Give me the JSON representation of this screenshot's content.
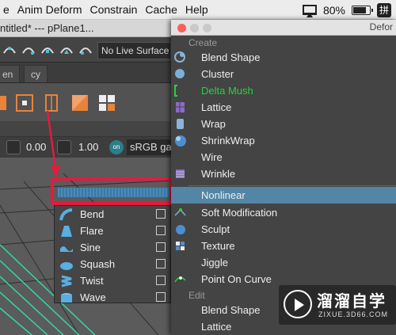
{
  "menubar": {
    "items": [
      "e",
      "Anim Deform",
      "Constrain",
      "Cache",
      "Help"
    ],
    "battery": "80%",
    "ime": "拼"
  },
  "maya": {
    "title": "ntitled*   ---   pPlane1...",
    "surface_dropdown": "No Live Surface",
    "shelf_tabs": [
      "en",
      "cy"
    ],
    "panel": {
      "value1": "0.00",
      "value2": "1.00",
      "colorspace_icon": "on",
      "colorspace": "sRGB gar"
    }
  },
  "nonlinear_submenu": {
    "items": [
      {
        "label": "Bend",
        "icon": "bend-icon"
      },
      {
        "label": "Flare",
        "icon": "flare-icon"
      },
      {
        "label": "Sine",
        "icon": "sine-icon"
      },
      {
        "label": "Squash",
        "icon": "squash-icon"
      },
      {
        "label": "Twist",
        "icon": "twist-icon"
      },
      {
        "label": "Wave",
        "icon": "wave-icon"
      }
    ]
  },
  "deform_window": {
    "title": "Defor",
    "create_header": "Create",
    "create_items": [
      {
        "label": "Blend Shape"
      },
      {
        "label": "Cluster"
      },
      {
        "label": "Delta Mush"
      },
      {
        "label": "Lattice"
      },
      {
        "label": "Wrap"
      },
      {
        "label": "ShrinkWrap"
      },
      {
        "label": "Wire"
      },
      {
        "label": "Wrinkle"
      },
      {
        "label": "Nonlinear"
      },
      {
        "label": "Soft Modification"
      },
      {
        "label": "Sculpt"
      },
      {
        "label": "Texture"
      },
      {
        "label": "Jiggle"
      },
      {
        "label": "Point On Curve"
      }
    ],
    "edit_header": "Edit",
    "edit_items": [
      {
        "label": "Blend Shape"
      },
      {
        "label": "Lattice"
      }
    ],
    "highlighted": "Nonlinear",
    "delta_mush_color": "#27d13f",
    "highlight_color": "#5285a6"
  },
  "watermark": {
    "title": "溜溜自学",
    "url": "ZIXUE.3D66.COM"
  },
  "colors": {
    "annotation_red": "#e8193d"
  }
}
